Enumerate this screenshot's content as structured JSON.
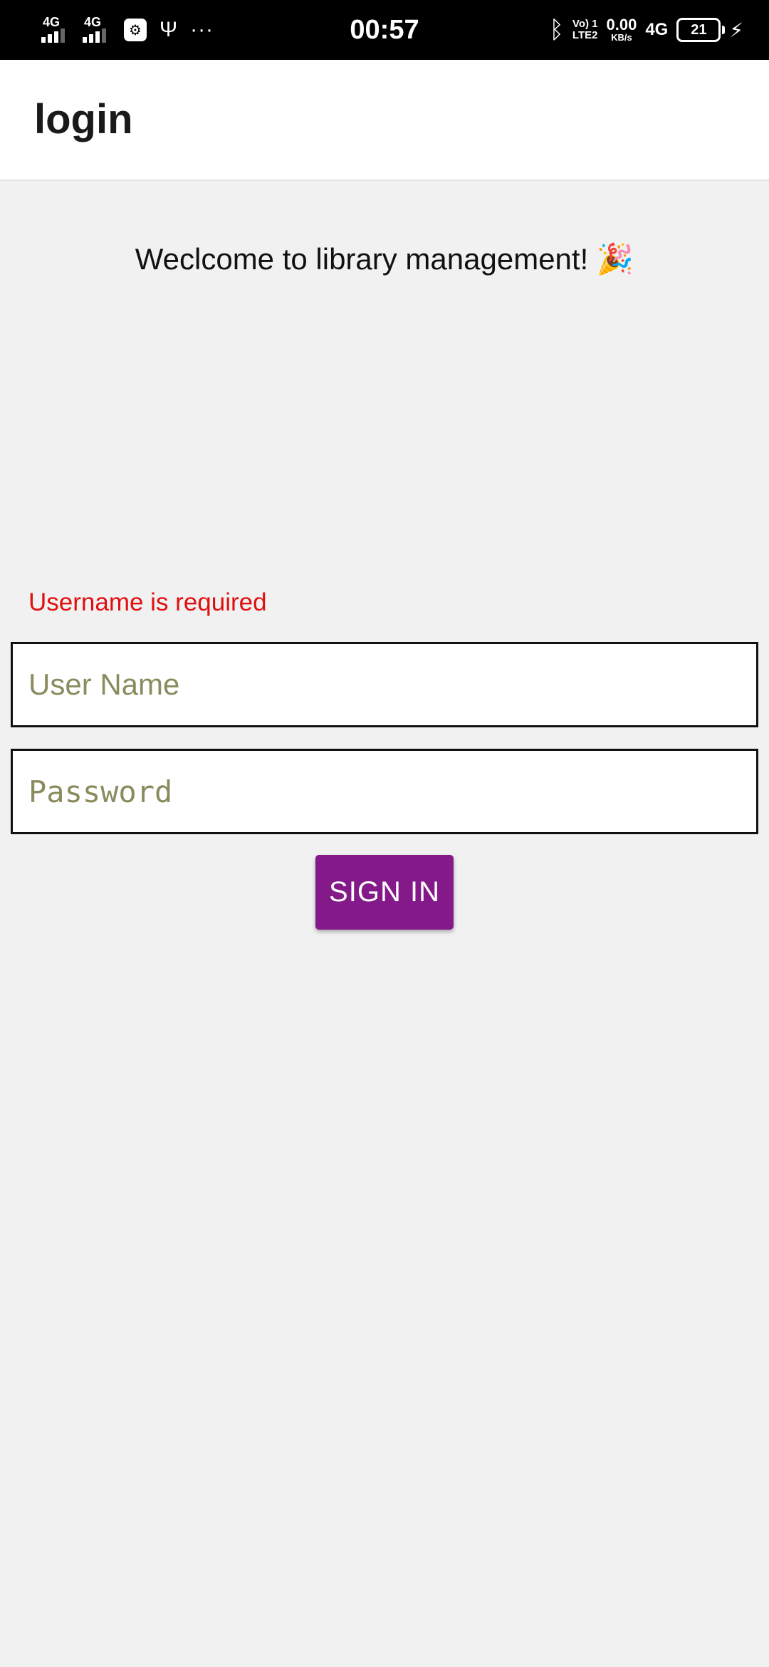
{
  "status_bar": {
    "sim1_network": "4G",
    "sim2_network": "4G",
    "usb_debug_icon": "usb-debug-icon",
    "usb_icon": "usb-icon",
    "overflow_dots": "···",
    "time": "00:57",
    "bluetooth_icon": "bluetooth-icon",
    "volte_top": "Vo) 1",
    "volte_bottom": "LTE2",
    "speed_value": "0.00",
    "speed_unit": "KB/s",
    "data_network": "4G",
    "battery_level": "21",
    "charging_icon": "bolt-icon"
  },
  "app_bar": {
    "title": "login"
  },
  "main": {
    "welcome_text": "Weclcome to library management! 🎉",
    "error_text": "Username is required",
    "username": {
      "value": "",
      "placeholder": "User Name"
    },
    "password": {
      "value": "",
      "placeholder": "Password"
    },
    "sign_in_label": "SIGN IN"
  },
  "colors": {
    "status_bar_bg": "#000000",
    "app_bar_bg": "#ffffff",
    "page_bg": "#f1f1f1",
    "error": "#e01010",
    "placeholder": "#8b8b5e",
    "button_bg": "#841a8a",
    "button_text": "#ffffff"
  }
}
